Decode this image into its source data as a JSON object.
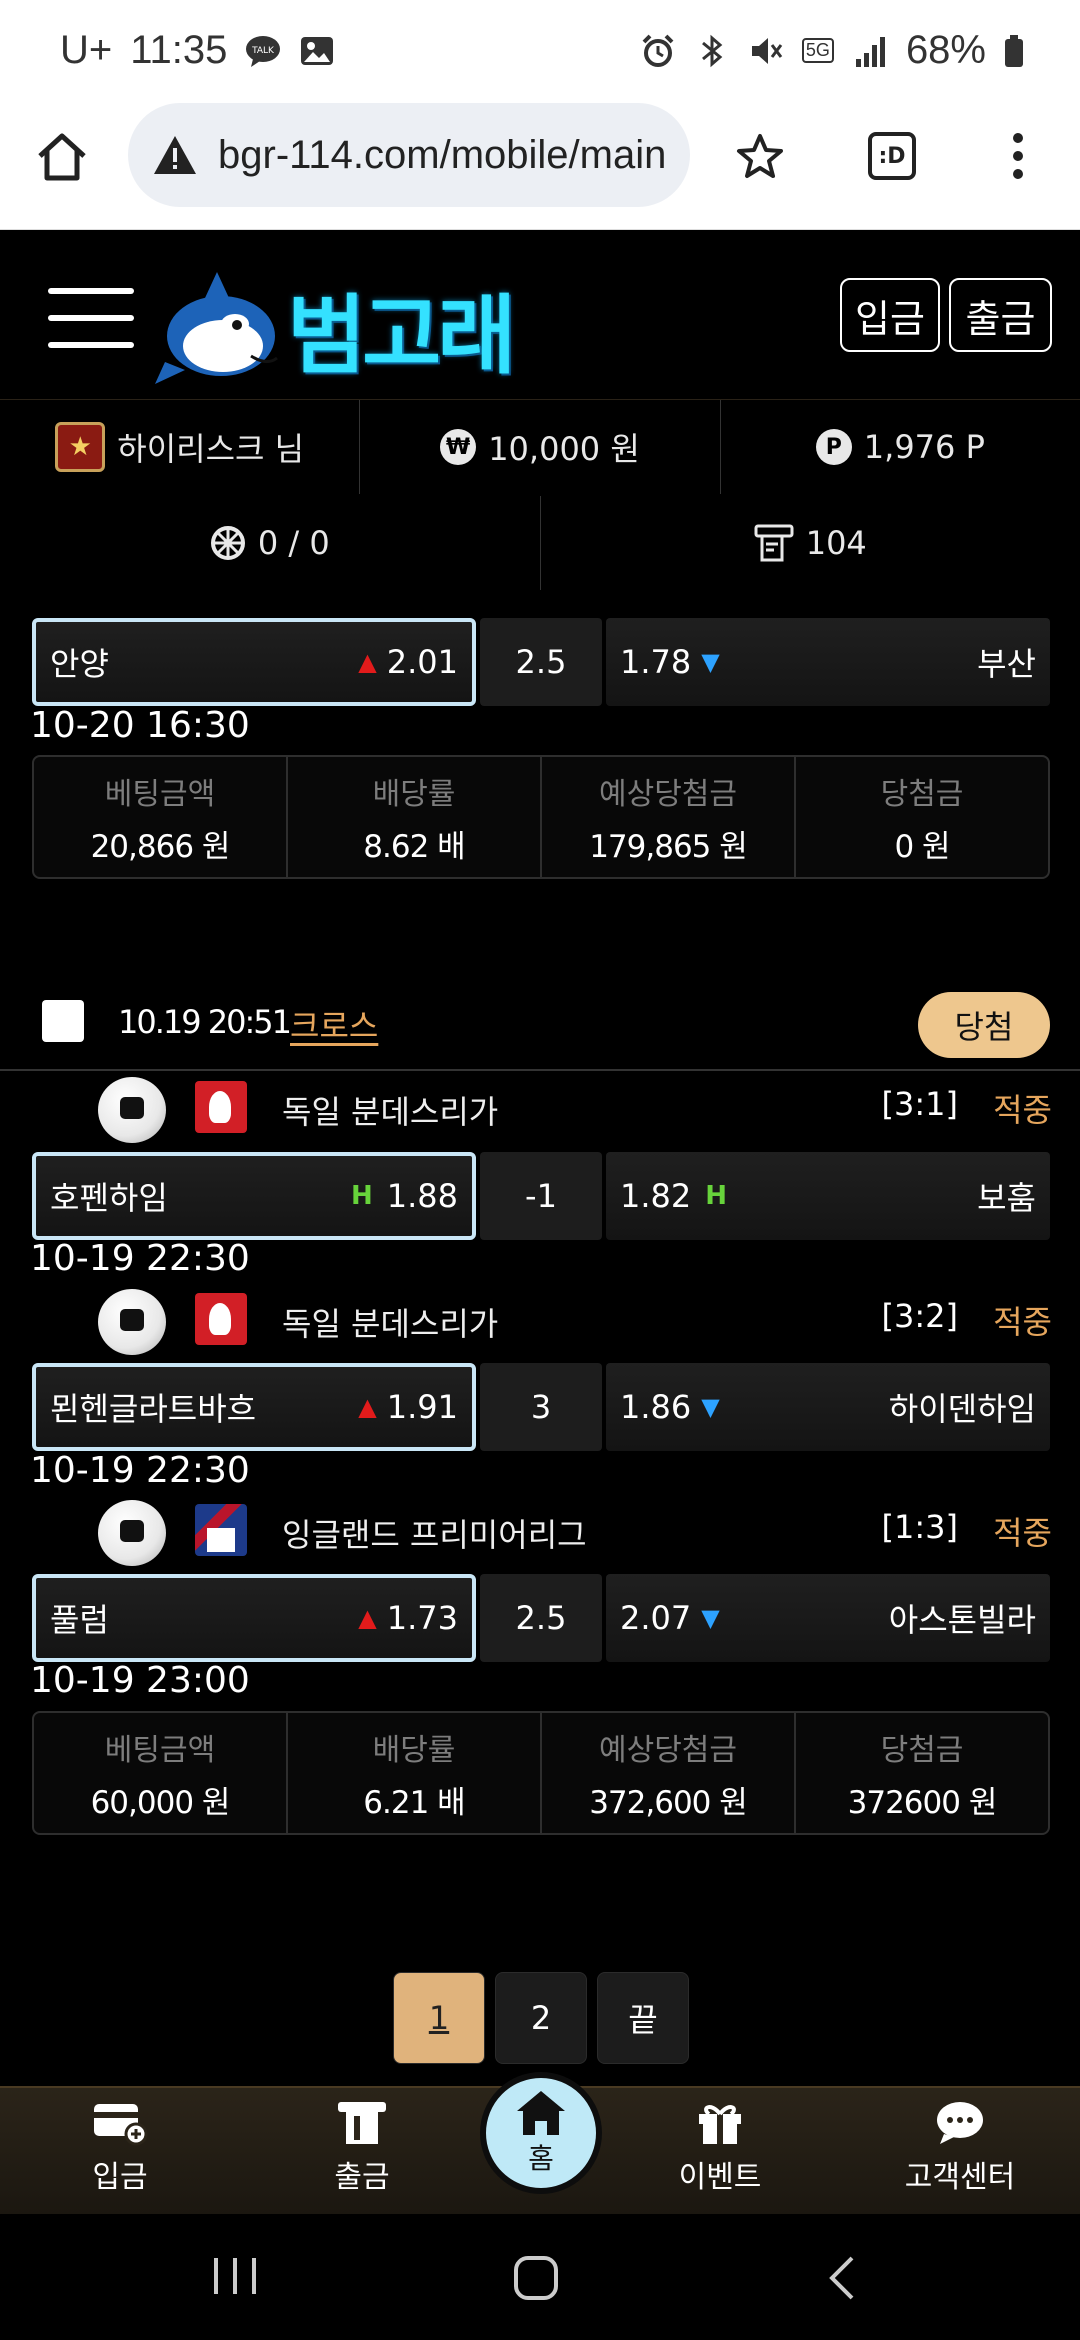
{
  "status_bar": {
    "carrier": "U+",
    "time": "11:35",
    "network": "5G",
    "battery": "68%"
  },
  "browser": {
    "url": "bgr-114.com/mobile/main",
    "tab_badge": ":D"
  },
  "site": {
    "logo_text": "범고래",
    "deposit_button": "입금",
    "withdraw_button": "출금"
  },
  "user": {
    "name": "하이리스크 님",
    "money": "10,000 원",
    "points": "1,976 P",
    "bets": "0 / 0",
    "count": "104"
  },
  "bet1": {
    "match": {
      "home": "안양",
      "home_odds": "2.01",
      "line": "2.5",
      "away_odds": "1.78",
      "away": "부산"
    },
    "date": "10-20 16:30",
    "summary_headers": [
      "베팅금액",
      "배당률",
      "예상당첨금",
      "당첨금"
    ],
    "summary_values": [
      "20,866 원",
      "8.62 배",
      "179,865 원",
      "0 원"
    ]
  },
  "bet2": {
    "time": "10.19 20:51",
    "type": "크로스",
    "result": "당첨",
    "games": [
      {
        "league": "독일 분데스리가",
        "score": "[3:1]",
        "status": "적중",
        "home": "호펜하임",
        "home_odds": "1.88",
        "line": "-1",
        "away_odds": "1.82",
        "away": "보훔",
        "date": "10-19 22:30",
        "mark": "H"
      },
      {
        "league": "독일 분데스리가",
        "score": "[3:2]",
        "status": "적중",
        "home": "묀헨글라트바흐",
        "home_odds": "1.91",
        "line": "3",
        "away_odds": "1.86",
        "away": "하이덴하임",
        "date": "10-19 22:30"
      },
      {
        "league": "잉글랜드 프리미어리그",
        "score": "[1:3]",
        "status": "적중",
        "home": "풀럼",
        "home_odds": "1.73",
        "line": "2.5",
        "away_odds": "2.07",
        "away": "아스톤빌라",
        "date": "10-19 23:00"
      }
    ],
    "summary_headers": [
      "베팅금액",
      "배당률",
      "예상당첨금",
      "당첨금"
    ],
    "summary_values": [
      "60,000 원",
      "6.21 배",
      "372,600 원",
      "372600 원"
    ]
  },
  "pagination": {
    "pages": [
      "1",
      "2",
      "끝"
    ]
  },
  "bottom_nav": {
    "deposit": "입금",
    "withdraw": "출금",
    "home": "홈",
    "event": "이벤트",
    "support": "고객센터"
  }
}
